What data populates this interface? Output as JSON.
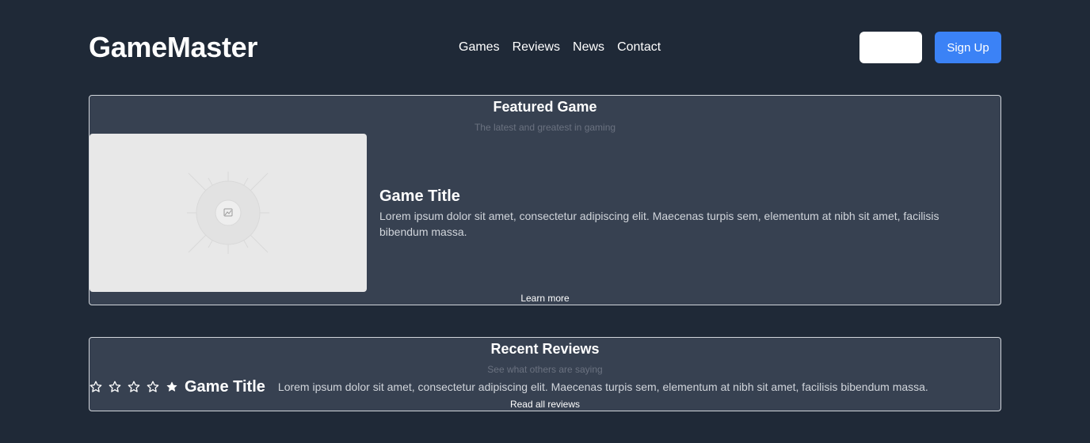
{
  "header": {
    "logo": "GameMaster",
    "nav": [
      "Games",
      "Reviews",
      "News",
      "Contact"
    ],
    "blank_button_label": "",
    "signup_label": "Sign Up"
  },
  "featured": {
    "title": "Featured Game",
    "subtitle": "The latest and greatest in gaming",
    "game_title": "Game Title",
    "description": "Lorem ipsum dolor sit amet, consectetur adipiscing elit. Maecenas turpis sem, elementum at nibh sit amet, facilisis bibendum massa.",
    "link": "Learn more"
  },
  "reviews": {
    "title": "Recent Reviews",
    "subtitle": "See what others are saying",
    "items": [
      {
        "stars": [
          "outline",
          "outline",
          "outline",
          "outline",
          "filled"
        ],
        "game_title": "Game Title",
        "text": "Lorem ipsum dolor sit amet, consectetur adipiscing elit. Maecenas turpis sem, elementum at nibh sit amet, facilisis bibendum massa."
      }
    ],
    "link": "Read all reviews"
  },
  "colors": {
    "background": "#1f2937",
    "card": "#374151",
    "accent": "#3b82f6"
  }
}
